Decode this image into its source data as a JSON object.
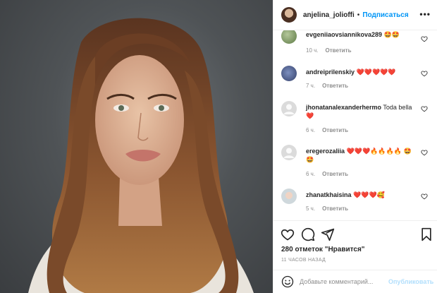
{
  "header": {
    "username": "anjelina_jolioffi",
    "dot": "•",
    "follow_label": "Подписаться",
    "more_icon": "•••"
  },
  "comments": [
    {
      "user": "evgeniiaovsiannikova289",
      "text": "🤩🤩",
      "time": "10 ч.",
      "reply": "Ответить",
      "avatar": "green-photo"
    },
    {
      "user": "andreiprilenskiy",
      "text": "❤️❤️❤️❤️❤️",
      "time": "7 ч.",
      "reply": "Ответить",
      "avatar": "blue-photo"
    },
    {
      "user": "jhonatanalexanderhermo",
      "text": "Toda bella ❤️",
      "time": "6 ч.",
      "reply": "Ответить",
      "avatar": "default"
    },
    {
      "user": "eregerozaliia",
      "text": "❤️❤️❤️🔥🔥🔥🔥 🤩🤩",
      "time": "6 ч.",
      "reply": "Ответить",
      "avatar": "default"
    },
    {
      "user": "zhanatkhaisina",
      "text": "❤️❤️❤️🥰",
      "time": "5 ч.",
      "reply": "Ответить",
      "avatar": "girl-photo"
    }
  ],
  "actions": {
    "likes": "280 отметок \"Нравится\"",
    "posted": "11 ЧАСОВ НАЗАД"
  },
  "add_comment": {
    "placeholder": "Добавьте комментарий...",
    "post_label": "Опубликовать"
  },
  "colors": {
    "link_blue": "#0095f6",
    "post_disabled": "#b2dffc",
    "meta_gray": "#8e8e8e",
    "divider": "#efefef"
  }
}
